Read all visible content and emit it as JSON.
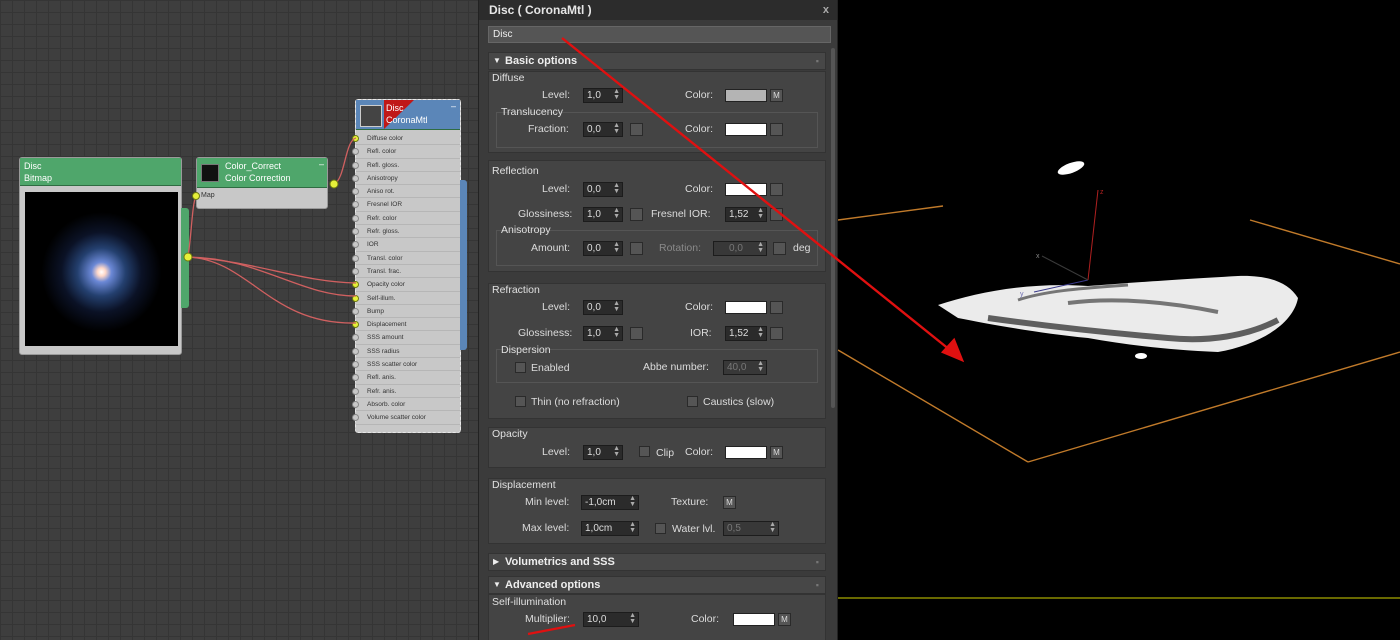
{
  "node_editor": {
    "bitmap_node": {
      "name": "Disc",
      "type": "Bitmap"
    },
    "color_correct_node": {
      "name": "Color_Correct",
      "type": "Color Correction",
      "slot": "Map"
    },
    "material_node": {
      "name": "Disc",
      "type": "CoronaMtl",
      "slots": [
        "Diffuse color",
        "Refl. color",
        "Refl. gloss.",
        "Anisotropy",
        "Aniso rot.",
        "Fresnel IOR",
        "Refr. color",
        "Refr. gloss.",
        "IOR",
        "Transl. color",
        "Transl. frac.",
        "Opacity color",
        "Self-illum.",
        "Bump",
        "Displacement",
        "SSS amount",
        "SSS radius",
        "SSS scatter color",
        "Refl. anis.",
        "Refr. anis.",
        "Absorb. color",
        "Volume scatter color"
      ],
      "connected_slots": [
        0,
        11,
        12,
        14
      ]
    }
  },
  "panel": {
    "title": "Disc  ( CoronaMtl )",
    "close": "x",
    "material_name": "Disc",
    "basic_options": {
      "header": "Basic options",
      "diffuse": {
        "group": "Diffuse",
        "level_label": "Level:",
        "level": "1,0",
        "color_label": "Color:",
        "map_btn": "M"
      },
      "translucency": {
        "group": "Translucency",
        "fraction_label": "Fraction:",
        "fraction": "0,0",
        "color_label": "Color:"
      }
    },
    "reflection": {
      "group": "Reflection",
      "level_label": "Level:",
      "level": "0,0",
      "color_label": "Color:",
      "glossiness_label": "Glossiness:",
      "glossiness": "1,0",
      "fresnel_label": "Fresnel IOR:",
      "fresnel": "1,52",
      "anisotropy": {
        "group": "Anisotropy",
        "amount_label": "Amount:",
        "amount": "0,0",
        "rotation_label": "Rotation:",
        "rotation": "0,0",
        "unit": "deg"
      }
    },
    "refraction": {
      "group": "Refraction",
      "level_label": "Level:",
      "level": "0,0",
      "color_label": "Color:",
      "glossiness_label": "Glossiness:",
      "glossiness": "1,0",
      "ior_label": "IOR:",
      "ior": "1,52",
      "dispersion": {
        "group": "Dispersion",
        "enabled_label": "Enabled",
        "abbe_label": "Abbe number:",
        "abbe": "40,0"
      },
      "thin_label": "Thin (no refraction)",
      "caustics_label": "Caustics (slow)"
    },
    "opacity": {
      "group": "Opacity",
      "level_label": "Level:",
      "level": "1,0",
      "clip_label": "Clip",
      "color_label": "Color:",
      "map_btn": "M"
    },
    "displacement": {
      "group": "Displacement",
      "min_label": "Min level:",
      "min": "-1,0cm",
      "max_label": "Max level:",
      "max": "1,0cm",
      "texture_label": "Texture:",
      "texture_btn": "M",
      "water_label": "Water lvl.",
      "water": "0,5"
    },
    "volumetrics_header": "Volumetrics and SSS",
    "advanced_header": "Advanced options",
    "self_illumination": {
      "group": "Self-illumination",
      "multiplier_label": "Multiplier:",
      "multiplier": "10,0",
      "color_label": "Color:",
      "map_btn": "M"
    }
  },
  "colors": {
    "accent_node": "#4fa66b",
    "material_node": "#5b86b8",
    "wire": "#d06060",
    "arrow": "#e01010",
    "grid": "#c07a2a"
  }
}
